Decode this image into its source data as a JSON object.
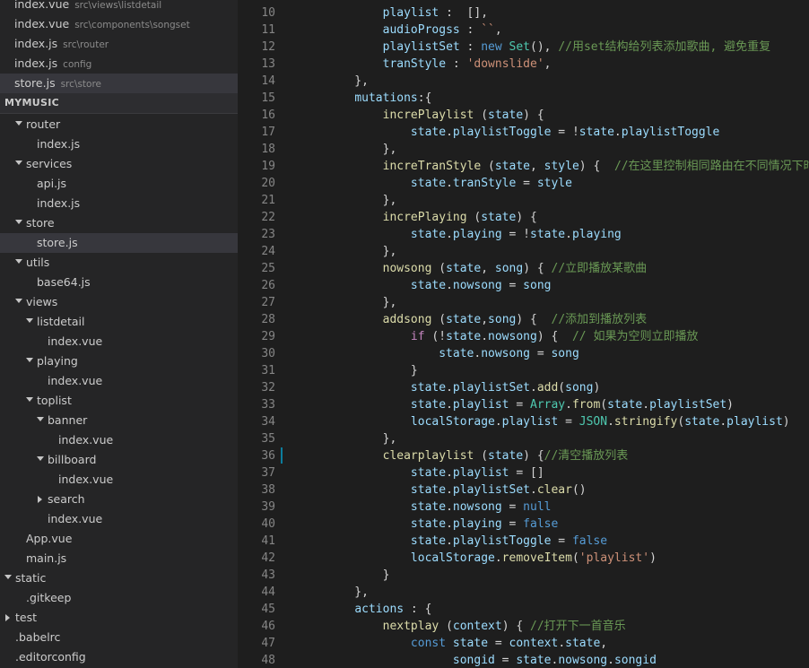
{
  "open_editors": [
    {
      "file": "index.vue",
      "path": "src\\views\\listdetail",
      "selected": false
    },
    {
      "file": "index.vue",
      "path": "src\\components\\songset",
      "selected": false
    },
    {
      "file": "index.js",
      "path": "src\\router",
      "selected": false
    },
    {
      "file": "index.js",
      "path": "config",
      "selected": false
    },
    {
      "file": "store.js",
      "path": "src\\store",
      "selected": true
    }
  ],
  "project_title": "MYMUSIC",
  "tree": [
    {
      "label": "router",
      "depth": 1,
      "arrow": "expanded"
    },
    {
      "label": "index.js",
      "depth": 2,
      "arrow": "none"
    },
    {
      "label": "services",
      "depth": 1,
      "arrow": "expanded"
    },
    {
      "label": "api.js",
      "depth": 2,
      "arrow": "none"
    },
    {
      "label": "index.js",
      "depth": 2,
      "arrow": "none"
    },
    {
      "label": "store",
      "depth": 1,
      "arrow": "expanded"
    },
    {
      "label": "store.js",
      "depth": 2,
      "arrow": "none",
      "selected": true
    },
    {
      "label": "utils",
      "depth": 1,
      "arrow": "expanded"
    },
    {
      "label": "base64.js",
      "depth": 2,
      "arrow": "none"
    },
    {
      "label": "views",
      "depth": 1,
      "arrow": "expanded"
    },
    {
      "label": "listdetail",
      "depth": 2,
      "arrow": "expanded"
    },
    {
      "label": "index.vue",
      "depth": 3,
      "arrow": "none"
    },
    {
      "label": "playing",
      "depth": 2,
      "arrow": "expanded"
    },
    {
      "label": "index.vue",
      "depth": 3,
      "arrow": "none"
    },
    {
      "label": "toplist",
      "depth": 2,
      "arrow": "expanded"
    },
    {
      "label": "banner",
      "depth": 3,
      "arrow": "expanded"
    },
    {
      "label": "index.vue",
      "depth": 4,
      "arrow": "none"
    },
    {
      "label": "billboard",
      "depth": 3,
      "arrow": "expanded"
    },
    {
      "label": "index.vue",
      "depth": 4,
      "arrow": "none"
    },
    {
      "label": "search",
      "depth": 3,
      "arrow": "collapsed"
    },
    {
      "label": "index.vue",
      "depth": 3,
      "arrow": "none"
    },
    {
      "label": "App.vue",
      "depth": 1,
      "arrow": "none"
    },
    {
      "label": "main.js",
      "depth": 1,
      "arrow": "none"
    },
    {
      "label": "static",
      "depth": 0,
      "arrow": "expanded"
    },
    {
      "label": ".gitkeep",
      "depth": 1,
      "arrow": "none"
    },
    {
      "label": "test",
      "depth": 0,
      "arrow": "collapsed"
    },
    {
      "label": ".babelrc",
      "depth": 0,
      "arrow": "none"
    },
    {
      "label": ".editorconfig",
      "depth": 0,
      "arrow": "none"
    }
  ],
  "code_lines": [
    {
      "n": 10,
      "tokens": [
        [
          "        ",
          "p"
        ],
        [
          "playlist",
          "prop"
        ],
        [
          " :  [],",
          "p"
        ]
      ]
    },
    {
      "n": 11,
      "tokens": [
        [
          "        ",
          "p"
        ],
        [
          "audioProgss",
          "prop"
        ],
        [
          " : ",
          "p"
        ],
        [
          "``",
          "str"
        ],
        [
          ",",
          "p"
        ]
      ]
    },
    {
      "n": 12,
      "tokens": [
        [
          "        ",
          "p"
        ],
        [
          "playlistSet",
          "prop"
        ],
        [
          " : ",
          "p"
        ],
        [
          "new",
          "kw"
        ],
        [
          " ",
          "p"
        ],
        [
          "Set",
          "type"
        ],
        [
          "(), ",
          "p"
        ],
        [
          "//用set结构给列表添加歌曲, 避免重复",
          "com"
        ]
      ]
    },
    {
      "n": 13,
      "tokens": [
        [
          "        ",
          "p"
        ],
        [
          "tranStyle",
          "prop"
        ],
        [
          " : ",
          "p"
        ],
        [
          "'downslide'",
          "str"
        ],
        [
          ",",
          "p"
        ]
      ]
    },
    {
      "n": 14,
      "tokens": [
        [
          "    },",
          "p"
        ]
      ]
    },
    {
      "n": 15,
      "tokens": [
        [
          "    ",
          "p"
        ],
        [
          "mutations",
          "prop"
        ],
        [
          ":{",
          "p"
        ]
      ]
    },
    {
      "n": 16,
      "tokens": [
        [
          "        ",
          "p"
        ],
        [
          "increPlaylist",
          "fn"
        ],
        [
          " (",
          "p"
        ],
        [
          "state",
          "prop"
        ],
        [
          ") {",
          "p"
        ]
      ]
    },
    {
      "n": 17,
      "tokens": [
        [
          "            ",
          "p"
        ],
        [
          "state",
          "prop"
        ],
        [
          ".",
          "p"
        ],
        [
          "playlistToggle",
          "prop"
        ],
        [
          " = !",
          "p"
        ],
        [
          "state",
          "prop"
        ],
        [
          ".",
          "p"
        ],
        [
          "playlistToggle",
          "prop"
        ]
      ]
    },
    {
      "n": 18,
      "tokens": [
        [
          "        },",
          "p"
        ]
      ]
    },
    {
      "n": 19,
      "tokens": [
        [
          "        ",
          "p"
        ],
        [
          "increTranStyle",
          "fn"
        ],
        [
          " (",
          "p"
        ],
        [
          "state",
          "prop"
        ],
        [
          ", ",
          "p"
        ],
        [
          "style",
          "prop"
        ],
        [
          ") {  ",
          "p"
        ],
        [
          "//在这里控制相同路由在不同情况下时,",
          "com"
        ]
      ]
    },
    {
      "n": 20,
      "tokens": [
        [
          "            ",
          "p"
        ],
        [
          "state",
          "prop"
        ],
        [
          ".",
          "p"
        ],
        [
          "tranStyle",
          "prop"
        ],
        [
          " = ",
          "p"
        ],
        [
          "style",
          "prop"
        ]
      ]
    },
    {
      "n": 21,
      "tokens": [
        [
          "        },",
          "p"
        ]
      ]
    },
    {
      "n": 22,
      "tokens": [
        [
          "        ",
          "p"
        ],
        [
          "increPlaying",
          "fn"
        ],
        [
          " (",
          "p"
        ],
        [
          "state",
          "prop"
        ],
        [
          ") {",
          "p"
        ]
      ]
    },
    {
      "n": 23,
      "tokens": [
        [
          "            ",
          "p"
        ],
        [
          "state",
          "prop"
        ],
        [
          ".",
          "p"
        ],
        [
          "playing",
          "prop"
        ],
        [
          " = !",
          "p"
        ],
        [
          "state",
          "prop"
        ],
        [
          ".",
          "p"
        ],
        [
          "playing",
          "prop"
        ]
      ]
    },
    {
      "n": 24,
      "tokens": [
        [
          "        },",
          "p"
        ]
      ]
    },
    {
      "n": 25,
      "tokens": [
        [
          "        ",
          "p"
        ],
        [
          "nowsong",
          "fn"
        ],
        [
          " (",
          "p"
        ],
        [
          "state",
          "prop"
        ],
        [
          ", ",
          "p"
        ],
        [
          "song",
          "prop"
        ],
        [
          ") { ",
          "p"
        ],
        [
          "//立即播放某歌曲",
          "com"
        ]
      ]
    },
    {
      "n": 26,
      "tokens": [
        [
          "            ",
          "p"
        ],
        [
          "state",
          "prop"
        ],
        [
          ".",
          "p"
        ],
        [
          "nowsong",
          "prop"
        ],
        [
          " = ",
          "p"
        ],
        [
          "song",
          "prop"
        ]
      ]
    },
    {
      "n": 27,
      "tokens": [
        [
          "        },",
          "p"
        ]
      ]
    },
    {
      "n": 28,
      "tokens": [
        [
          "        ",
          "p"
        ],
        [
          "addsong",
          "fn"
        ],
        [
          " (",
          "p"
        ],
        [
          "state",
          "prop"
        ],
        [
          ",",
          "p"
        ],
        [
          "song",
          "prop"
        ],
        [
          ") {  ",
          "p"
        ],
        [
          "//添加到播放列表",
          "com"
        ]
      ]
    },
    {
      "n": 29,
      "tokens": [
        [
          "            ",
          "p"
        ],
        [
          "if",
          "ctrl"
        ],
        [
          " (!",
          "p"
        ],
        [
          "state",
          "prop"
        ],
        [
          ".",
          "p"
        ],
        [
          "nowsong",
          "prop"
        ],
        [
          ") {  ",
          "p"
        ],
        [
          "// 如果为空则立即播放",
          "com"
        ]
      ]
    },
    {
      "n": 30,
      "tokens": [
        [
          "                ",
          "p"
        ],
        [
          "state",
          "prop"
        ],
        [
          ".",
          "p"
        ],
        [
          "nowsong",
          "prop"
        ],
        [
          " = ",
          "p"
        ],
        [
          "song",
          "prop"
        ]
      ]
    },
    {
      "n": 31,
      "tokens": [
        [
          "            }",
          "p"
        ]
      ]
    },
    {
      "n": 32,
      "tokens": [
        [
          "            ",
          "p"
        ],
        [
          "state",
          "prop"
        ],
        [
          ".",
          "p"
        ],
        [
          "playlistSet",
          "prop"
        ],
        [
          ".",
          "p"
        ],
        [
          "add",
          "fn"
        ],
        [
          "(",
          "p"
        ],
        [
          "song",
          "prop"
        ],
        [
          ")",
          "p"
        ]
      ]
    },
    {
      "n": 33,
      "tokens": [
        [
          "            ",
          "p"
        ],
        [
          "state",
          "prop"
        ],
        [
          ".",
          "p"
        ],
        [
          "playlist",
          "prop"
        ],
        [
          " = ",
          "p"
        ],
        [
          "Array",
          "type"
        ],
        [
          ".",
          "p"
        ],
        [
          "from",
          "fn"
        ],
        [
          "(",
          "p"
        ],
        [
          "state",
          "prop"
        ],
        [
          ".",
          "p"
        ],
        [
          "playlistSet",
          "prop"
        ],
        [
          ")",
          "p"
        ]
      ]
    },
    {
      "n": 34,
      "tokens": [
        [
          "            ",
          "p"
        ],
        [
          "localStorage",
          "prop"
        ],
        [
          ".",
          "p"
        ],
        [
          "playlist",
          "prop"
        ],
        [
          " = ",
          "p"
        ],
        [
          "JSON",
          "type"
        ],
        [
          ".",
          "p"
        ],
        [
          "stringify",
          "fn"
        ],
        [
          "(",
          "p"
        ],
        [
          "state",
          "prop"
        ],
        [
          ".",
          "p"
        ],
        [
          "playlist",
          "prop"
        ],
        [
          ")",
          "p"
        ]
      ]
    },
    {
      "n": 35,
      "tokens": [
        [
          "        },",
          "p"
        ]
      ]
    },
    {
      "n": 36,
      "tokens": [
        [
          "        ",
          "p"
        ],
        [
          "clearplaylist",
          "fn"
        ],
        [
          " (",
          "p"
        ],
        [
          "state",
          "prop"
        ],
        [
          ") {",
          "p"
        ],
        [
          "//清空播放列表",
          "com"
        ]
      ]
    },
    {
      "n": 37,
      "tokens": [
        [
          "            ",
          "p"
        ],
        [
          "state",
          "prop"
        ],
        [
          ".",
          "p"
        ],
        [
          "playlist",
          "prop"
        ],
        [
          " = []",
          "p"
        ]
      ]
    },
    {
      "n": 38,
      "tokens": [
        [
          "            ",
          "p"
        ],
        [
          "state",
          "prop"
        ],
        [
          ".",
          "p"
        ],
        [
          "playlistSet",
          "prop"
        ],
        [
          ".",
          "p"
        ],
        [
          "clear",
          "fn"
        ],
        [
          "()",
          "p"
        ]
      ]
    },
    {
      "n": 39,
      "tokens": [
        [
          "            ",
          "p"
        ],
        [
          "state",
          "prop"
        ],
        [
          ".",
          "p"
        ],
        [
          "nowsong",
          "prop"
        ],
        [
          " = ",
          "p"
        ],
        [
          "null",
          "kw"
        ]
      ]
    },
    {
      "n": 40,
      "tokens": [
        [
          "            ",
          "p"
        ],
        [
          "state",
          "prop"
        ],
        [
          ".",
          "p"
        ],
        [
          "playing",
          "prop"
        ],
        [
          " = ",
          "p"
        ],
        [
          "false",
          "kw"
        ]
      ]
    },
    {
      "n": 41,
      "tokens": [
        [
          "            ",
          "p"
        ],
        [
          "state",
          "prop"
        ],
        [
          ".",
          "p"
        ],
        [
          "playlistToggle",
          "prop"
        ],
        [
          " = ",
          "p"
        ],
        [
          "false",
          "kw"
        ]
      ]
    },
    {
      "n": 42,
      "tokens": [
        [
          "            ",
          "p"
        ],
        [
          "localStorage",
          "prop"
        ],
        [
          ".",
          "p"
        ],
        [
          "removeItem",
          "fn"
        ],
        [
          "(",
          "p"
        ],
        [
          "'playlist'",
          "str"
        ],
        [
          ")",
          "p"
        ]
      ]
    },
    {
      "n": 43,
      "tokens": [
        [
          "        }",
          "p"
        ]
      ]
    },
    {
      "n": 44,
      "tokens": [
        [
          "    },",
          "p"
        ]
      ]
    },
    {
      "n": 45,
      "tokens": [
        [
          "    ",
          "p"
        ],
        [
          "actions",
          "prop"
        ],
        [
          " : {",
          "p"
        ]
      ]
    },
    {
      "n": 46,
      "tokens": [
        [
          "        ",
          "p"
        ],
        [
          "nextplay",
          "fn"
        ],
        [
          " (",
          "p"
        ],
        [
          "context",
          "prop"
        ],
        [
          ") { ",
          "p"
        ],
        [
          "//打开下一首音乐",
          "com"
        ]
      ]
    },
    {
      "n": 47,
      "tokens": [
        [
          "            ",
          "p"
        ],
        [
          "const",
          "kw"
        ],
        [
          " ",
          "p"
        ],
        [
          "state",
          "prop"
        ],
        [
          " = ",
          "p"
        ],
        [
          "context",
          "prop"
        ],
        [
          ".",
          "p"
        ],
        [
          "state",
          "prop"
        ],
        [
          ",",
          "p"
        ]
      ]
    },
    {
      "n": 48,
      "tokens": [
        [
          "                  ",
          "p"
        ],
        [
          "songid",
          "prop"
        ],
        [
          " = ",
          "p"
        ],
        [
          "state",
          "prop"
        ],
        [
          ".",
          "p"
        ],
        [
          "nowsong",
          "prop"
        ],
        [
          ".",
          "p"
        ],
        [
          "songid",
          "prop"
        ]
      ]
    }
  ]
}
